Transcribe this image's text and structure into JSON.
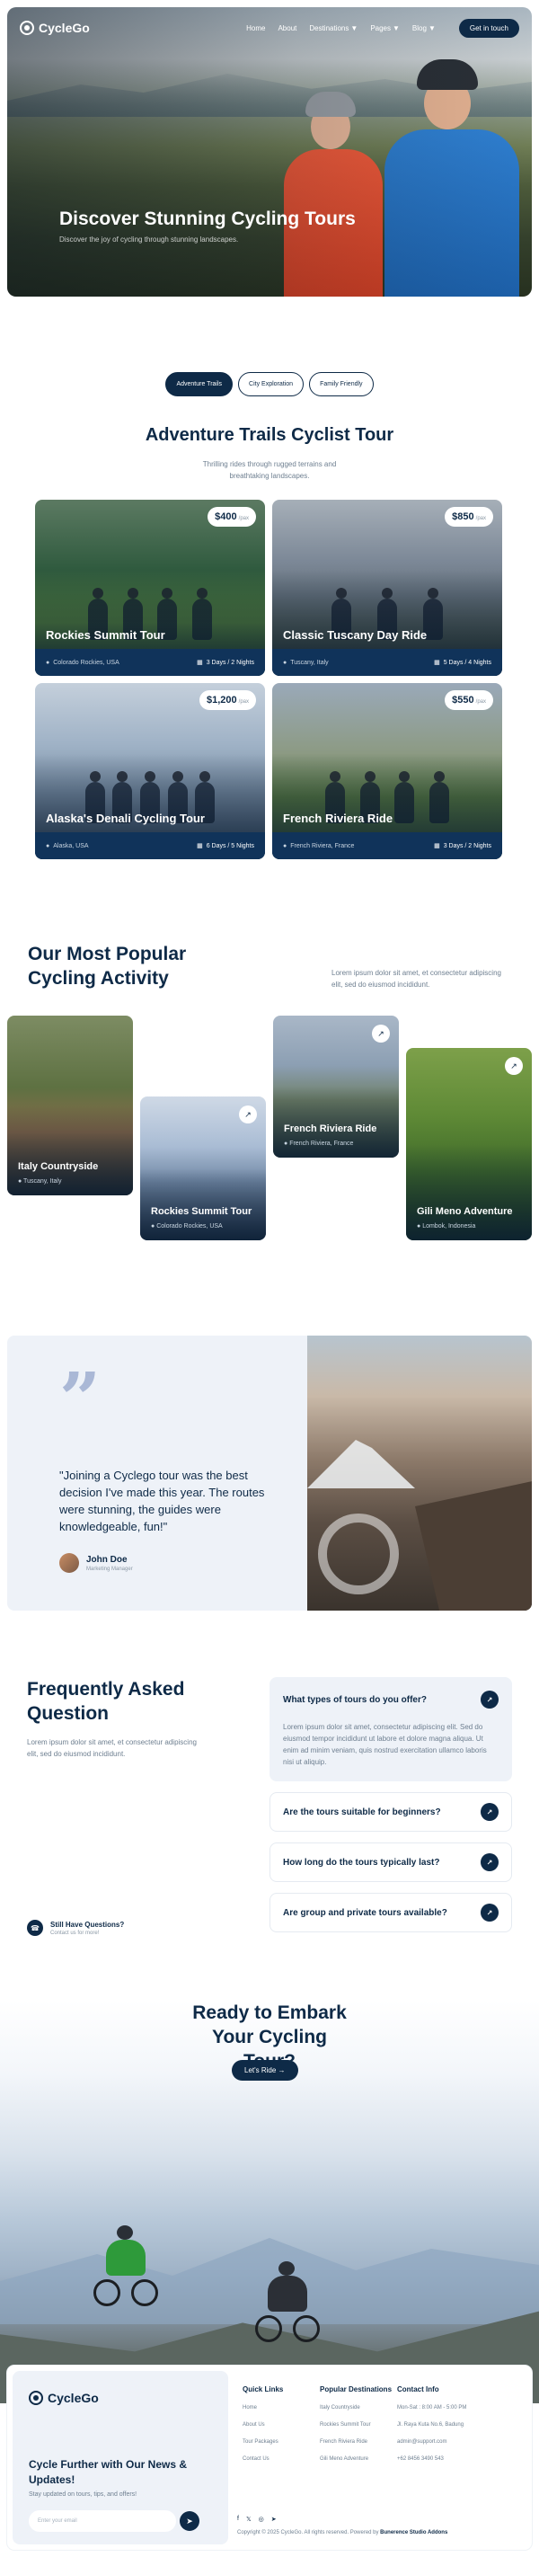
{
  "nav": {
    "logo": "CycleGo",
    "links": [
      "Home",
      "About",
      "Destinations",
      "Pages",
      "Blog"
    ],
    "cta": "Get in touch"
  },
  "hero": {
    "title": "Discover Stunning Cycling Tours",
    "subtitle": "Discover the joy of cycling through stunning landscapes."
  },
  "trails": {
    "tabs": [
      "Adventure Trails",
      "City Exploration",
      "Family Friendly"
    ],
    "title": "Adventure Trails Cyclist Tour",
    "subtitle": "Thrilling rides through rugged terrains and breathtaking landscapes.",
    "cards": [
      {
        "title": "Rockies Summit Tour",
        "price": "$400",
        "unit": "/pax",
        "location": "Colorado Rockies, USA",
        "duration": "3 Days / 2 Nights"
      },
      {
        "title": "Classic Tuscany Day Ride",
        "price": "$850",
        "unit": "/pax",
        "location": "Tuscany, Italy",
        "duration": "5 Days / 4 Nights"
      },
      {
        "title": "Alaska's Denali Cycling Tour",
        "price": "$1,200",
        "unit": "/pax",
        "location": "Alaska, USA",
        "duration": "6 Days / 5 Nights"
      },
      {
        "title": "French Riviera Ride",
        "price": "$550",
        "unit": "/pax",
        "location": "French Riviera, France",
        "duration": "3 Days / 2 Nights"
      }
    ]
  },
  "popular": {
    "title": "Our Most Popular Cycling Activity",
    "desc": "Lorem ipsum dolor sit amet, et consectetur adipiscing elit, sed do eiusmod incididunt.",
    "cards": [
      {
        "title": "Italy Countryside",
        "location": "Tuscany, Italy"
      },
      {
        "title": "Rockies Summit Tour",
        "location": "Colorado Rockies, USA"
      },
      {
        "title": "French Riviera Ride",
        "location": "French Riviera, France"
      },
      {
        "title": "Gili Meno Adventure",
        "location": "Lombok, Indonesia"
      }
    ]
  },
  "testimonial": {
    "quote": "\"Joining a Cyclego tour was the best decision I've made this year. The routes were stunning, the guides were knowledgeable, fun!\"",
    "name": "John Doe",
    "role": "Marketing Manager"
  },
  "faq": {
    "title": "Frequently Asked Question",
    "desc": "Lorem ipsum dolor sit amet, et consectetur adipiscing elit, sed do eiusmod incididunt.",
    "still_title": "Still Have Questions?",
    "still_sub": "Contact us for more!",
    "items": [
      {
        "q": "What types of tours do you offer?",
        "a": "Lorem ipsum dolor sit amet, consectetur adipiscing elit. Sed do eiusmod tempor incididunt ut labore et dolore magna aliqua. Ut enim ad minim veniam, quis nostrud exercitation ullamco laboris nisi ut aliquip."
      },
      {
        "q": "Are the tours suitable for beginners?"
      },
      {
        "q": "How long do the tours typically last?"
      },
      {
        "q": "Are group and private tours available?"
      }
    ]
  },
  "cta": {
    "title": "Ready to Embark Your Cycling Tour?",
    "button": "Let's Ride"
  },
  "footer": {
    "logo": "CycleGo",
    "news_title": "Cycle Further with Our News & Updates!",
    "news_sub": "Stay updated on tours, tips, and offers!",
    "email_placeholder": "Enter your email",
    "cols": [
      {
        "title": "Quick Links",
        "items": [
          "Home",
          "About Us",
          "Tour Packages",
          "Contact Us"
        ]
      },
      {
        "title": "Popular Destinations",
        "items": [
          "Italy Countryside",
          "Rockies Summit Tour",
          "French Riviera Ride",
          "Gili Meno Adventure"
        ]
      },
      {
        "title": "Contact Info",
        "items": [
          "Mon-Sat : 8:00 AM - 5:00 PM",
          "Jl. Raya Kuta No.6, Badung",
          "admin@support.com",
          "+62 8456 3490 543"
        ]
      }
    ],
    "copyright": "Copyright © 2025 CycleGo. All rights reserved. Powered by",
    "powered": "Bunerence Studio Addons"
  },
  "icons": {
    "arrow": "north-east-arrow",
    "location": "map-pin",
    "calendar": "calendar",
    "phone": "phone"
  }
}
